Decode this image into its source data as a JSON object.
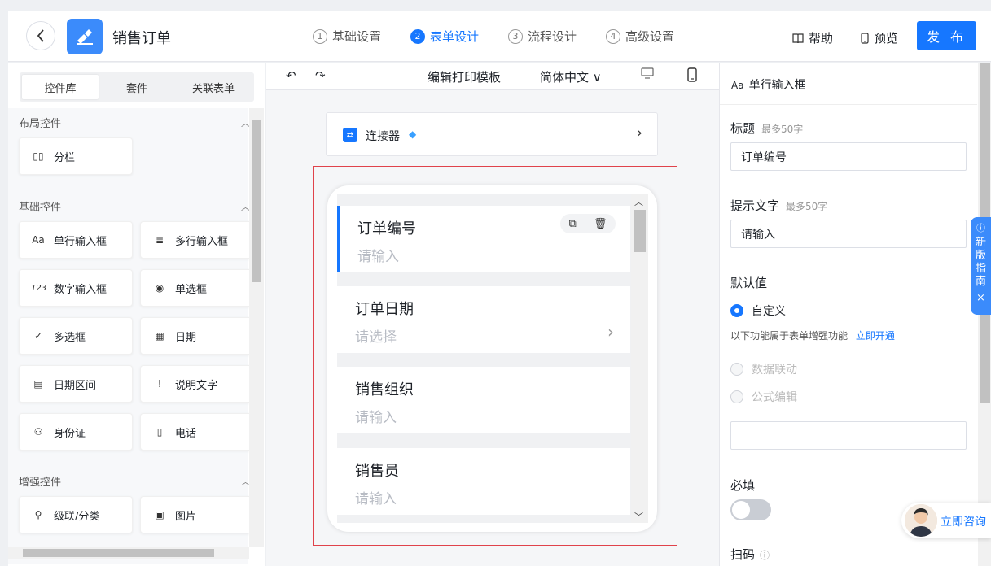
{
  "header": {
    "back_icon": "chevron-left-icon",
    "app_title": "销售订单",
    "steps": [
      {
        "num": "1",
        "label": "基础设置"
      },
      {
        "num": "2",
        "label": "表单设计"
      },
      {
        "num": "3",
        "label": "流程设计"
      },
      {
        "num": "4",
        "label": "高级设置"
      }
    ],
    "help": "帮助",
    "preview": "预览",
    "publish": "发 布",
    "accent": "#1677ff"
  },
  "left": {
    "tabs": [
      "控件库",
      "套件",
      "关联表单"
    ],
    "sections": {
      "layout": {
        "title": "布局控件",
        "items": [
          {
            "icon": "▯▯",
            "label": "分栏"
          }
        ]
      },
      "basic": {
        "title": "基础控件",
        "items": [
          {
            "icon": "Aa",
            "label": "单行输入框"
          },
          {
            "icon": "≣",
            "label": "多行输入框"
          },
          {
            "icon": "123",
            "label": "数字输入框"
          },
          {
            "icon": "◉",
            "label": "单选框"
          },
          {
            "icon": "✓",
            "label": "多选框"
          },
          {
            "icon": "▦",
            "label": "日期"
          },
          {
            "icon": "▤",
            "label": "日期区间"
          },
          {
            "icon": "!",
            "label": "说明文字"
          },
          {
            "icon": "⚇",
            "label": "身份证"
          },
          {
            "icon": "▯",
            "label": "电话"
          }
        ]
      },
      "enhanced": {
        "title": "增强控件",
        "items": [
          {
            "icon": "⚲",
            "label": "级联/分类"
          },
          {
            "icon": "▣",
            "label": "图片"
          }
        ]
      }
    }
  },
  "center": {
    "toolbar": {
      "print_template": "编辑打印模板",
      "language": "简体中文"
    },
    "connector": {
      "label": "连接器"
    },
    "fields": [
      {
        "label": "订单编号",
        "placeholder": "请输入"
      },
      {
        "label": "订单日期",
        "placeholder": "请选择"
      },
      {
        "label": "销售组织",
        "placeholder": "请输入"
      },
      {
        "label": "销售员",
        "placeholder": "请输入"
      }
    ]
  },
  "right": {
    "component": "单行输入框",
    "component_icon": "Aa",
    "title_label": "标题",
    "title_hint": "最多50字",
    "title_value": "订单编号",
    "prompt_label": "提示文字",
    "prompt_hint": "最多50字",
    "prompt_value": "请输入",
    "default_label": "默认值",
    "custom": "自定义",
    "enhance_note": "以下功能属于表单增强功能",
    "enhance_link": "立即开通",
    "linkage": "数据联动",
    "formula": "公式编辑",
    "required": "必填",
    "scan": "扫码"
  },
  "guide": {
    "text": "新版指南"
  },
  "consult": {
    "text": "立即咨询"
  }
}
